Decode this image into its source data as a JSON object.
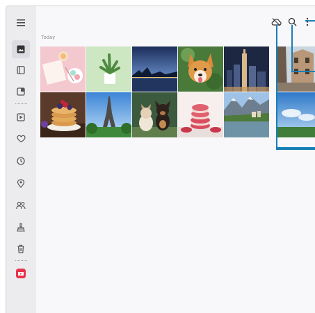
{
  "colors": {
    "rail_bg": "#ececef",
    "callout": "#1a7fb8",
    "accent_red": "#e8334a"
  },
  "header": {
    "section_label": "Today"
  },
  "nav_rail": [
    {
      "name": "menu-icon"
    },
    {
      "name": "pictures-icon",
      "selected": true
    },
    {
      "name": "albums-icon"
    },
    {
      "name": "stories-icon"
    },
    {
      "name": "videos-icon"
    },
    {
      "name": "favorites-icon"
    },
    {
      "name": "recent-icon"
    },
    {
      "name": "locations-icon"
    },
    {
      "name": "shared-icon"
    },
    {
      "name": "suggestions-icon"
    },
    {
      "name": "trash-icon"
    },
    {
      "name": "youtube-icon"
    }
  ],
  "toolbar": [
    {
      "name": "cloud-off-icon"
    },
    {
      "name": "search-icon"
    },
    {
      "name": "more-options-icon"
    }
  ],
  "photos": [
    {
      "subject": "pink-desk-macarons"
    },
    {
      "subject": "succulent-plant"
    },
    {
      "subject": "city-bridge-night"
    },
    {
      "subject": "corgi-dog"
    },
    {
      "subject": "city-skyline-night"
    },
    {
      "subject": "pancakes-berries"
    },
    {
      "subject": "eiffel-tower"
    },
    {
      "subject": "puppy-and-kitten"
    },
    {
      "subject": "macaron-stack"
    },
    {
      "subject": "lakeside-village"
    },
    {
      "subject": "old-town-street"
    },
    {
      "subject": "blue-sky-meadow"
    }
  ]
}
